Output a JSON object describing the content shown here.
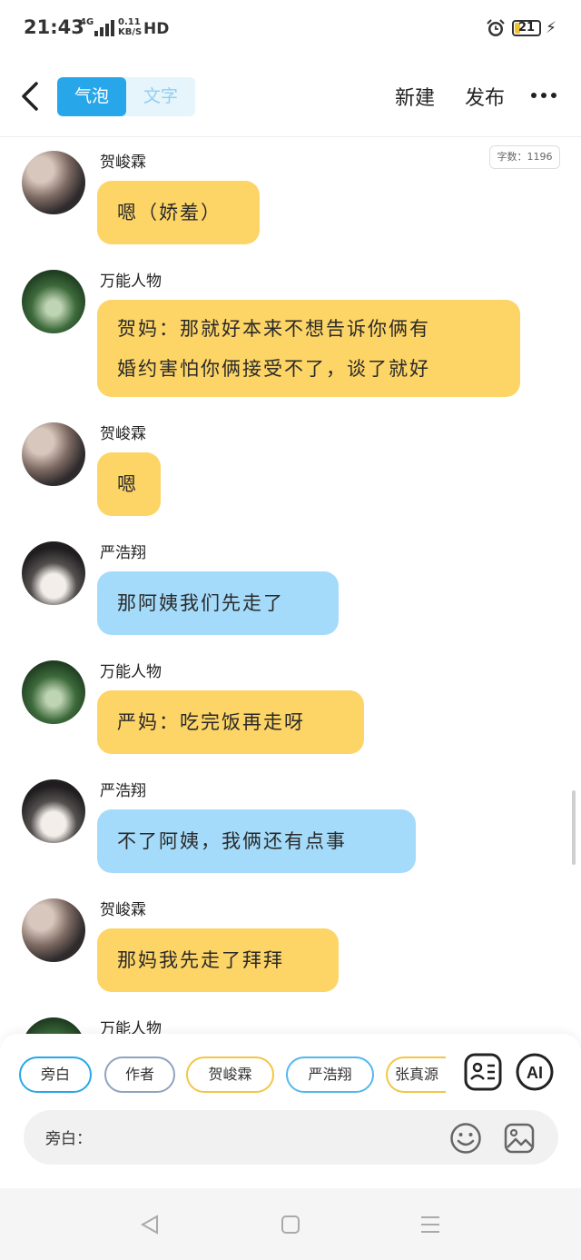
{
  "status_bar": {
    "time": "21:43",
    "network": "4G",
    "speed_value": "0.11",
    "speed_unit": "KB/S",
    "hd": "HD",
    "battery": "21",
    "battery_level": 0.21,
    "battery_color": "#f2c12e"
  },
  "header": {
    "tabs": [
      {
        "label": "气泡",
        "active": true
      },
      {
        "label": "文字",
        "active": false
      }
    ],
    "new_label": "新建",
    "publish_label": "发布"
  },
  "word_count": "字数：1196",
  "messages": [
    {
      "name": "贺峻霖",
      "text": "嗯（娇羞）",
      "color": "yellow",
      "avatar": "he"
    },
    {
      "name": "万能人物",
      "lines": [
        "贺妈：那就好本来不想告诉你俩有",
        "婚约害怕你俩接受不了，谈了就好"
      ],
      "color": "yellow",
      "avatar": "wn"
    },
    {
      "name": "贺峻霖",
      "text": "嗯",
      "color": "yellow",
      "avatar": "he"
    },
    {
      "name": "严浩翔",
      "text": "那阿姨我们先走了",
      "color": "blue",
      "avatar": "yan"
    },
    {
      "name": "万能人物",
      "text": "严妈：吃完饭再走呀",
      "color": "yellow",
      "avatar": "wn"
    },
    {
      "name": "严浩翔",
      "text": "不了阿姨，我俩还有点事",
      "color": "blue",
      "avatar": "yan"
    },
    {
      "name": "贺峻霖",
      "text": "那妈我先走了拜拜",
      "color": "yellow",
      "avatar": "he"
    },
    {
      "name": "万能人物",
      "avatar": "wn"
    }
  ],
  "colors": {
    "yellow": "#fdd466",
    "blue": "#a5dbfa",
    "accent": "#27a7ea"
  },
  "role_chips": [
    {
      "label": "旁白",
      "border": "#27a7ea"
    },
    {
      "label": "作者",
      "border": "#8fa3bd"
    },
    {
      "label": "贺峻霖",
      "border": "#f3c644"
    },
    {
      "label": "严浩翔",
      "border": "#54b7ec"
    },
    {
      "label": "张真源",
      "border": "#f3c644"
    }
  ],
  "ai_label": "AI",
  "input": {
    "label": "旁白：",
    "placeholder": ""
  },
  "icons": {
    "back": "chevron-left-icon",
    "more": "more-horizontal-icon",
    "roles": "role-card-icon",
    "emoji": "emoji-icon",
    "image": "image-icon"
  }
}
